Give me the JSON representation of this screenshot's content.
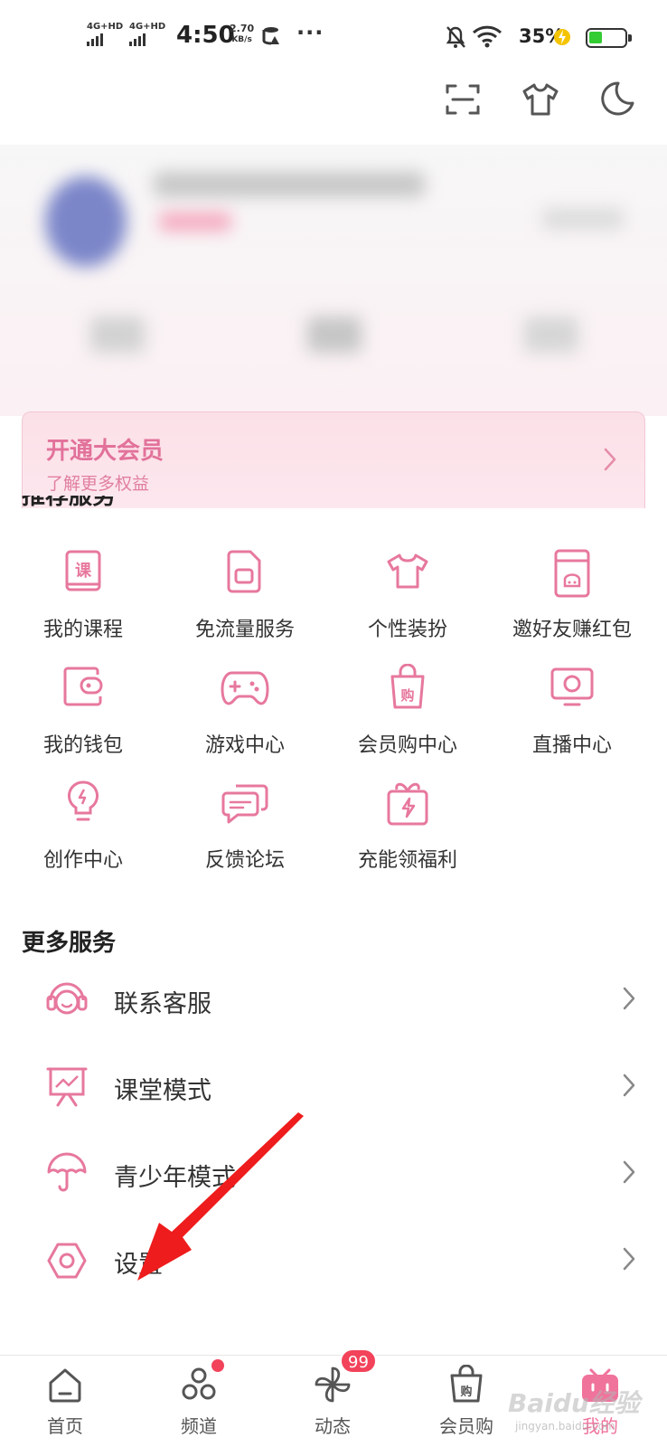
{
  "status_bar": {
    "net1": "4G+HD",
    "net2": "4G+HD",
    "time": "4:50",
    "speed_value": "2.70",
    "speed_unit": "KB/s",
    "more": "···",
    "battery_pct": "35%"
  },
  "vip_banner": {
    "title": "开通大会员",
    "subtitle": "了解更多权益"
  },
  "recommended": {
    "title": "推荐服务",
    "items": [
      {
        "label": "我的课程",
        "icon": "course-book-icon"
      },
      {
        "label": "免流量服务",
        "icon": "sim-card-icon"
      },
      {
        "label": "个性装扮",
        "icon": "tshirt-icon"
      },
      {
        "label": "邀好友赚红包",
        "icon": "red-packet-icon"
      },
      {
        "label": "我的钱包",
        "icon": "wallet-icon"
      },
      {
        "label": "游戏中心",
        "icon": "gamepad-icon"
      },
      {
        "label": "会员购中心",
        "icon": "shopping-bag-icon"
      },
      {
        "label": "直播中心",
        "icon": "live-tv-icon"
      },
      {
        "label": "创作中心",
        "icon": "lightbulb-icon"
      },
      {
        "label": "反馈论坛",
        "icon": "chat-bubbles-icon"
      },
      {
        "label": "充能领福利",
        "icon": "gift-bolt-icon"
      }
    ]
  },
  "more_services": {
    "title": "更多服务",
    "items": [
      {
        "label": "联系客服",
        "icon": "headset-icon"
      },
      {
        "label": "课堂模式",
        "icon": "classroom-board-icon"
      },
      {
        "label": "青少年模式",
        "icon": "umbrella-icon"
      },
      {
        "label": "设置",
        "icon": "settings-hexagon-icon"
      }
    ]
  },
  "tabbar": {
    "items": [
      {
        "label": "首页",
        "icon": "home-icon"
      },
      {
        "label": "频道",
        "icon": "channel-icon"
      },
      {
        "label": "动态",
        "icon": "pinwheel-icon",
        "badge": "99"
      },
      {
        "label": "会员购",
        "icon": "shopping-bag-icon"
      },
      {
        "label": "我的",
        "icon": "tv-mascot-icon"
      }
    ]
  },
  "watermark": {
    "text": "Baidu经验",
    "sub": "jingyan.baidu.com"
  },
  "colors": {
    "accent": "#f0739b",
    "icon_pink": "#e7789d",
    "badge_red": "#f2435a",
    "arrow_red": "#ee1c1c"
  }
}
